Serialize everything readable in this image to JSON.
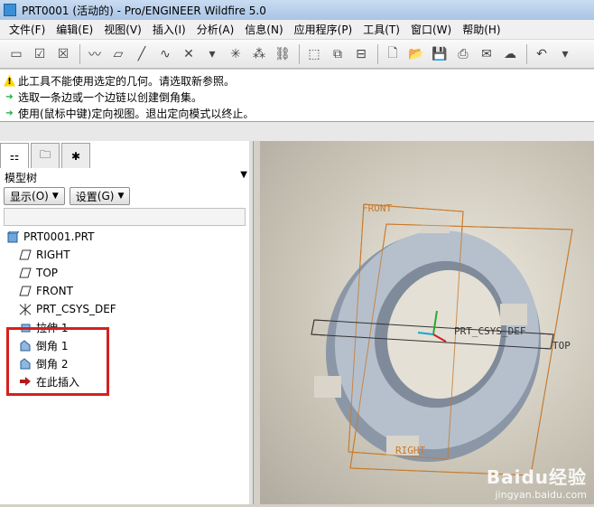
{
  "window": {
    "title": "PRT0001 (活动的) - Pro/ENGINEER Wildfire 5.0"
  },
  "menu": [
    "文件(F)",
    "编辑(E)",
    "视图(V)",
    "插入(I)",
    "分析(A)",
    "信息(N)",
    "应用程序(P)",
    "工具(T)",
    "窗口(W)",
    "帮助(H)"
  ],
  "messages": [
    {
      "type": "warning",
      "text": "此工具不能使用选定的几何。请选取新参照。"
    },
    {
      "type": "prompt",
      "text": "选取一条边或一个边链以创建倒角集。"
    },
    {
      "type": "prompt",
      "text": "使用(鼠标中键)定向视图。退出定向模式以终止。"
    }
  ],
  "model_tree": {
    "header": "模型树",
    "show_button": "显示",
    "show_shortcut": "(O)",
    "settings_button": "设置",
    "settings_shortcut": "(G)",
    "root": "PRT0001.PRT",
    "items": [
      {
        "label": "RIGHT",
        "icon": "datum-plane-icon"
      },
      {
        "label": "TOP",
        "icon": "datum-plane-icon"
      },
      {
        "label": "FRONT",
        "icon": "datum-plane-icon"
      },
      {
        "label": "PRT_CSYS_DEF",
        "icon": "csys-icon"
      },
      {
        "label": "拉伸 1",
        "icon": "extrude-icon"
      },
      {
        "label": "倒角 1",
        "icon": "chamfer-icon"
      },
      {
        "label": "倒角 2",
        "icon": "chamfer-icon"
      },
      {
        "label": "在此插入",
        "icon": "insert-here-icon"
      }
    ]
  },
  "viewport": {
    "datum_labels": {
      "front": "FRONT",
      "top": "TOP",
      "right": "RIGHT",
      "csys": "PRT_CSYS_DEF"
    }
  },
  "watermark": {
    "logo": "Baidu经验",
    "url": "jingyan.baidu.com"
  },
  "colors": {
    "highlight": "#d62020",
    "datum": "#c8782a",
    "part": "#a9b3c0"
  }
}
